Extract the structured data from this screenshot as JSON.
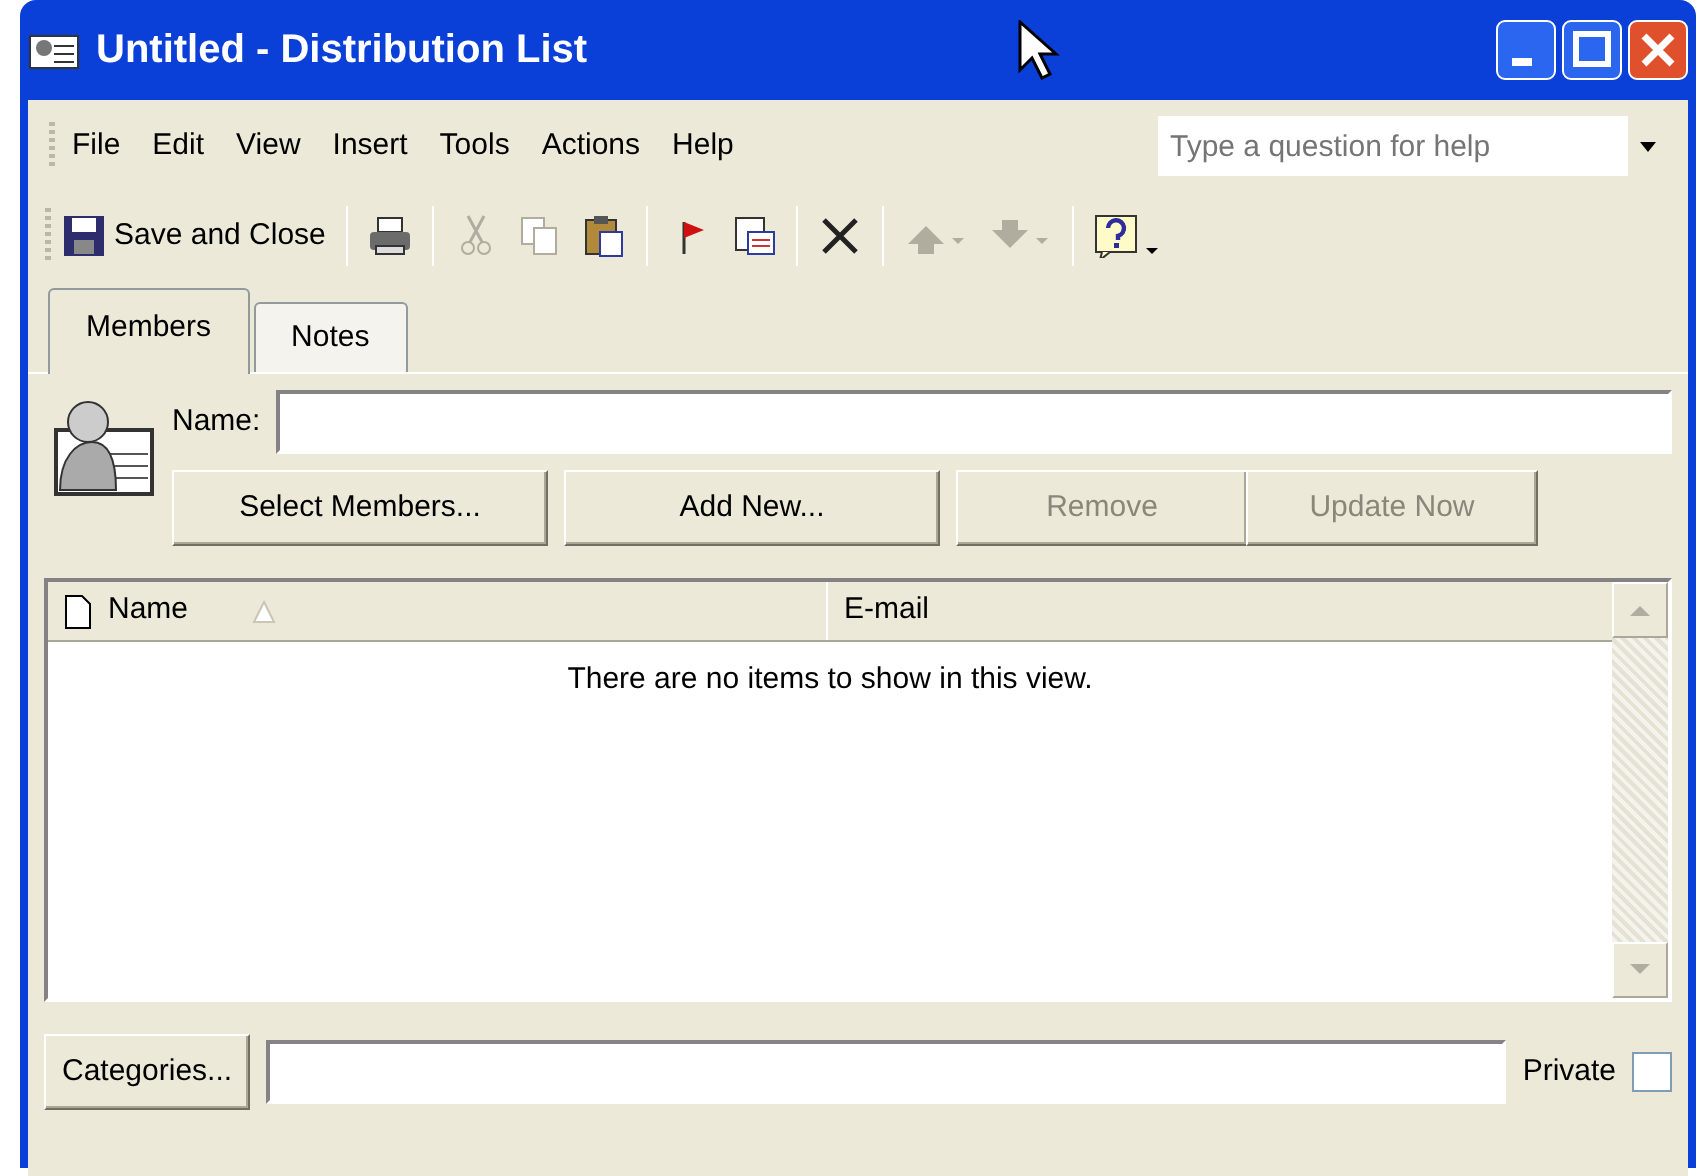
{
  "window": {
    "title": "Untitled - Distribution List"
  },
  "menu": [
    {
      "label": "File"
    },
    {
      "label": "Edit"
    },
    {
      "label": "View"
    },
    {
      "label": "Insert"
    },
    {
      "label": "Tools"
    },
    {
      "label": "Actions"
    },
    {
      "label": "Help"
    }
  ],
  "help_box": {
    "placeholder": "Type a question for help"
  },
  "toolbar": [
    [
      {
        "kind": "save",
        "label": "Save and Close",
        "disabled": false
      }
    ],
    [
      {
        "kind": "print",
        "disabled": false
      }
    ],
    [
      {
        "kind": "cut",
        "disabled": true
      },
      {
        "kind": "copy",
        "disabled": true
      },
      {
        "kind": "paste",
        "disabled": false
      }
    ],
    [
      {
        "kind": "flag",
        "disabled": false
      },
      {
        "kind": "card",
        "disabled": false
      }
    ],
    [
      {
        "kind": "delete",
        "disabled": false
      }
    ],
    [
      {
        "kind": "up",
        "disabled": true
      },
      {
        "kind": "down",
        "disabled": true
      }
    ],
    [
      {
        "kind": "help",
        "disabled": false
      }
    ]
  ],
  "tabs": [
    {
      "label": "Members",
      "selected": true
    },
    {
      "label": "Notes",
      "selected": false
    }
  ],
  "name_field": {
    "label": "Name:"
  },
  "buttons": [
    {
      "label": "Select Members...",
      "disabled": false
    },
    {
      "label": "Add New...",
      "disabled": false
    },
    {
      "label": "Remove",
      "disabled": true
    },
    {
      "label": "Update Now",
      "disabled": true
    }
  ],
  "table": {
    "columns": [
      "Name",
      "E-mail"
    ],
    "empty_message": "There are no items to show in this view."
  },
  "categories_button": {
    "label": "Categories..."
  },
  "private": {
    "label": "Private",
    "checked": false
  }
}
